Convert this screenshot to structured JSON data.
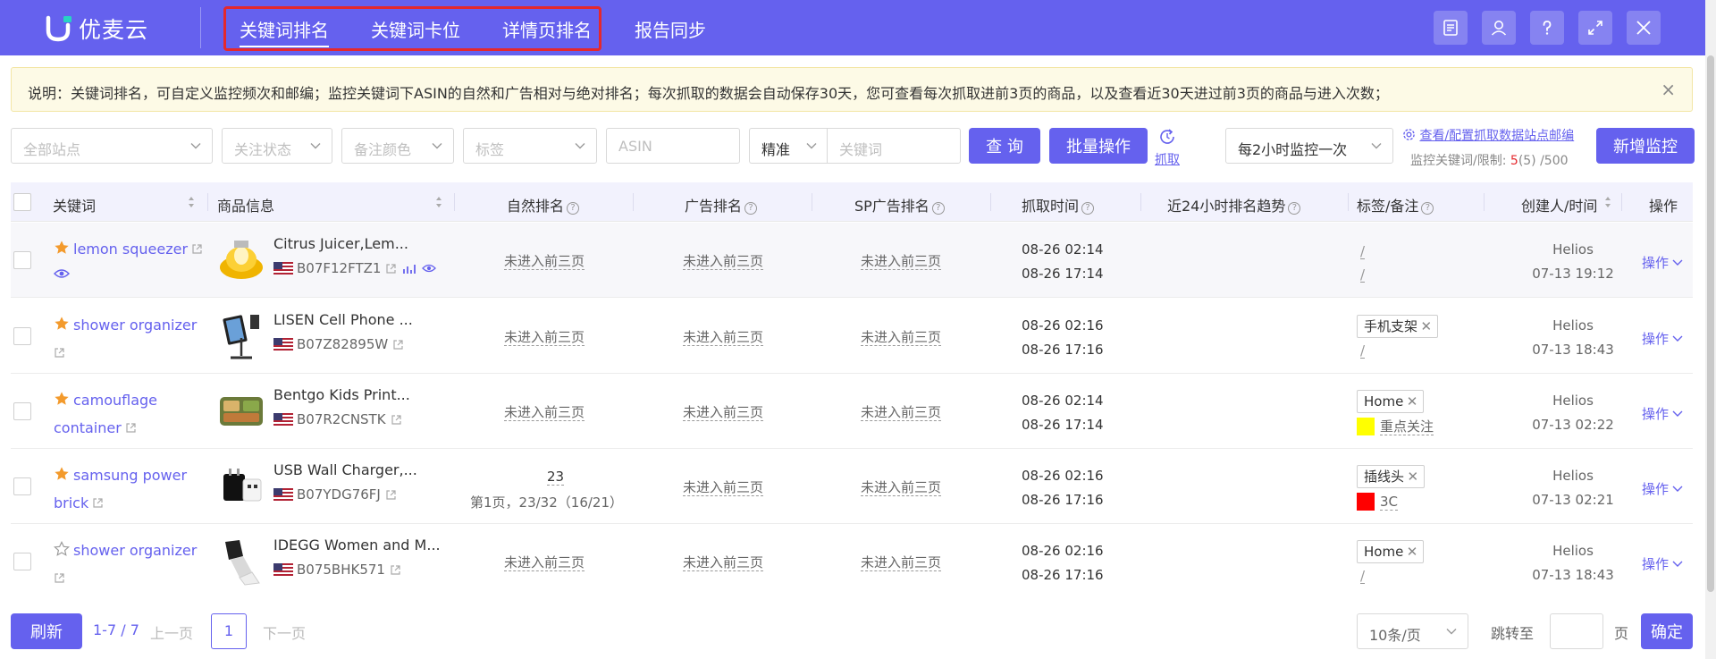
{
  "app": {
    "name": "优麦云"
  },
  "nav": {
    "tabs": [
      {
        "label": "关键词排名"
      },
      {
        "label": "关键词卡位"
      },
      {
        "label": "详情页排名"
      },
      {
        "label": "报告同步"
      }
    ]
  },
  "header_icons": [
    "document-icon",
    "user-icon",
    "help-icon",
    "fullscreen-icon",
    "close-icon"
  ],
  "notice": {
    "text": "说明：关键词排名，可自定义监控频次和邮编；监控关键词下ASIN的自然和广告相对与绝对排名；每次抓取的数据会自动保存30天，您可查看每次抓取进前3页的商品，以及查看近30天进过前3页的商品与进入次数；",
    "close": "×"
  },
  "filters": {
    "site": "全部站点",
    "follow": "关注状态",
    "note_color": "备注颜色",
    "tag": "标签",
    "asin": "ASIN",
    "match": "精准",
    "keyword": "关键词",
    "query_btn": "查 询",
    "batch_btn": "批量操作",
    "grab_label": "抓取",
    "frequency": "每2小时监控一次",
    "config_link": "查看/配置抓取数据站点邮编",
    "limit_label": "监控关键词/限制:",
    "limit_used": "5",
    "limit_rest": "(5) /500",
    "add_btn": "新增监控"
  },
  "table": {
    "headers": {
      "keyword": "关键词",
      "product": "商品信息",
      "natural": "自然排名",
      "ad": "广告排名",
      "sp": "SP广告排名",
      "time": "抓取时间",
      "trend": "近24小时排名趋势",
      "tag": "标签/备注",
      "creator": "创建人/时间",
      "op": "操作"
    },
    "rows": [
      {
        "keyword": "lemon squeezer",
        "starred": true,
        "title": "Citrus Juicer,Lem...",
        "asin": "B07F12FTZ1",
        "natural": "未进入前三页",
        "ad": "未进入前三页",
        "sp": "未进入前三页",
        "time1": "08-26 02:14",
        "time2": "08-26 17:14",
        "tag": "",
        "note": "/",
        "creator": "Helios",
        "created": "07-13 19:12",
        "op": "操作"
      },
      {
        "keyword": "shower organizer",
        "starred": true,
        "title": "LISEN Cell Phone ...",
        "asin": "B07Z82895W",
        "natural": "未进入前三页",
        "ad": "未进入前三页",
        "sp": "未进入前三页",
        "time1": "08-26 02:16",
        "time2": "08-26 17:16",
        "tag": "手机支架",
        "note": "/",
        "creator": "Helios",
        "created": "07-13 18:43",
        "op": "操作"
      },
      {
        "keyword_line1": "camouflage",
        "keyword_line2": "container",
        "starred": true,
        "title": "Bentgo Kids Print...",
        "asin": "B07R2CNSTK",
        "natural": "未进入前三页",
        "ad": "未进入前三页",
        "sp": "未进入前三页",
        "time1": "08-26 02:14",
        "time2": "08-26 17:14",
        "tag": "Home",
        "note": "重点关注",
        "note_color": "#ffff00",
        "creator": "Helios",
        "created": "07-13 02:22",
        "op": "操作"
      },
      {
        "keyword_line1": "samsung power",
        "keyword_line2": "brick",
        "starred": true,
        "title": "USB Wall Charger,...",
        "asin": "B07YDG76FJ",
        "natural": "23",
        "natural_detail": "第1页，23/32（16/21）",
        "ad": "未进入前三页",
        "sp": "未进入前三页",
        "time1": "08-26 02:16",
        "time2": "08-26 17:16",
        "tag": "插线头",
        "note": "3C",
        "note_color": "#ff0000",
        "creator": "Helios",
        "created": "07-13 02:21",
        "op": "操作"
      },
      {
        "keyword": "shower organizer",
        "starred": false,
        "title": "IDEGG Women and M...",
        "asin": "B075BHK571",
        "natural": "未进入前三页",
        "ad": "未进入前三页",
        "sp": "未进入前三页",
        "time1": "08-26 02:16",
        "time2": "08-26 17:16",
        "tag": "Home",
        "note": "/",
        "creator": "Helios",
        "created": "07-13 18:43",
        "op": "操作"
      }
    ]
  },
  "pagination": {
    "refresh": "刷新",
    "range": "1-7 / 7",
    "prev": "上一页",
    "page": "1",
    "next": "下一页",
    "page_size": "10条/页",
    "jump_label": "跳转至",
    "page_unit": "页",
    "confirm": "确定"
  },
  "colors": {
    "accent": "#6561ee",
    "highlight_border": "#e5282c"
  }
}
